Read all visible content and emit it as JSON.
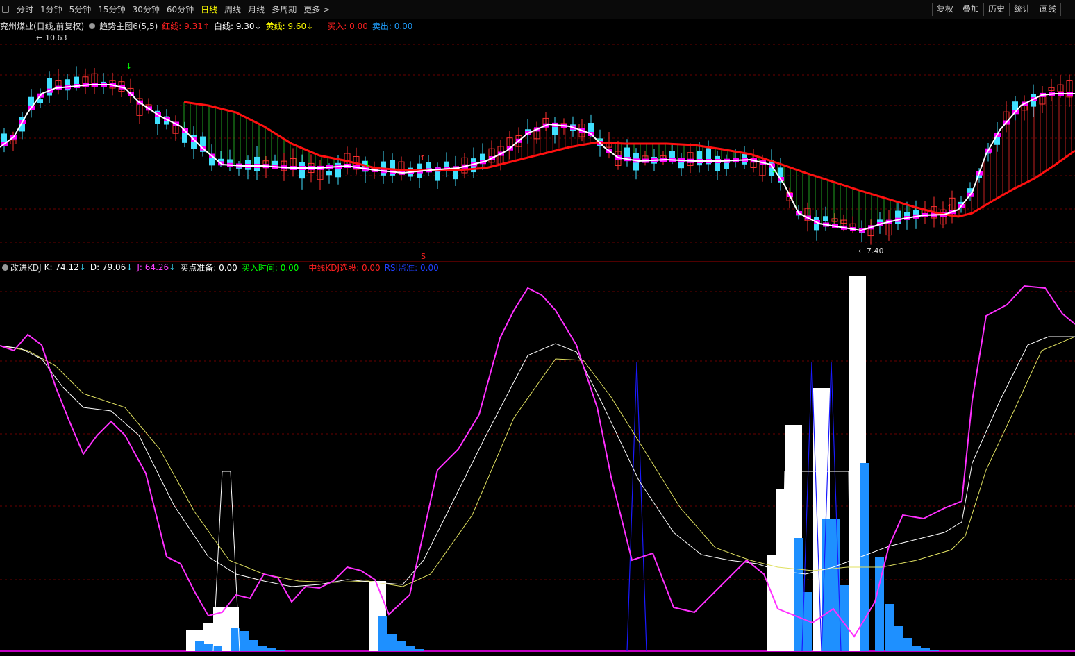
{
  "toolbar": {
    "periods": [
      "分时",
      "1分钟",
      "5分钟",
      "15分钟",
      "30分钟",
      "60分钟",
      "日线",
      "周线",
      "月线",
      "多周期",
      "更多 >"
    ],
    "active_period": "日线",
    "tools": [
      "复权",
      "叠加",
      "历史",
      "统计",
      "画线"
    ]
  },
  "main_chart": {
    "stock_title": "兖州煤业(日线,前复权)",
    "indicator": "趋势主图6(5,5)",
    "red_line": {
      "label": "红线:",
      "value": "9.31",
      "arrow": "↑",
      "color": "#ff2020"
    },
    "white_line": {
      "label": "白线:",
      "value": "9.30",
      "arrow": "↓",
      "color": "#ffffff"
    },
    "yellow_line": {
      "label": "黄线:",
      "value": "9.60",
      "arrow": "↓",
      "color": "#ffff00"
    },
    "buy": {
      "label": "买入:",
      "value": "0.00",
      "color": "#ff2020"
    },
    "sell": {
      "label": "卖出:",
      "value": "0.00",
      "color": "#20a0ff"
    },
    "high_marker": "10.63",
    "low_marker": "7.40",
    "event_marker": "S"
  },
  "sub_chart": {
    "indicator": "改进KDJ",
    "k": {
      "label": "K:",
      "value": "74.12",
      "arrow": "↓",
      "color": "#ffffff"
    },
    "d": {
      "label": "D:",
      "value": "79.06",
      "arrow": "↓",
      "color": "#ffff00"
    },
    "j": {
      "label": "J:",
      "value": "64.26",
      "arrow": "↓",
      "color": "#ff40ff"
    },
    "ready": {
      "label": "买点准备:",
      "value": "0.00",
      "color": "#ffffff"
    },
    "buy_time": {
      "label": "买入时间:",
      "value": "0.00",
      "color": "#00ff00"
    },
    "mid_kdj": {
      "label": "中线KDJ选股:",
      "value": "0.00",
      "color": "#ff2020"
    },
    "rsi": {
      "label": "RSI监准:",
      "value": "0.00",
      "color": "#2040ff"
    }
  },
  "colors": {
    "up": "#ff3030",
    "down": "#40e0ff",
    "bg": "#000000",
    "grid": "#8b0000",
    "magenta": "#ff00ff",
    "histogram_blue": "#1e90ff"
  }
}
